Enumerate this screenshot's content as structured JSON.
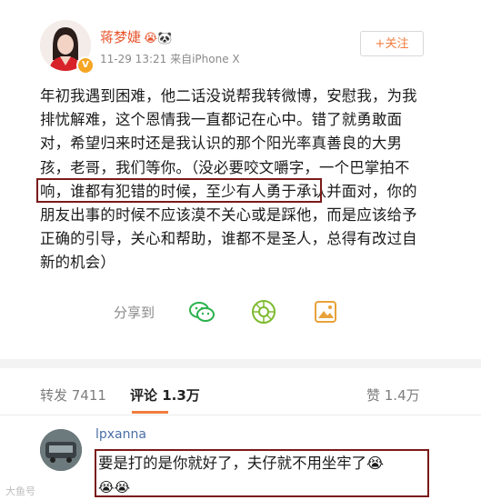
{
  "post": {
    "username": "蒋梦婕",
    "name_emojis": "😭🐼",
    "meta": "11-29 13:21  来自iPhone X",
    "follow_label": "+关注",
    "text": "年初我遇到困难，他二话没说帮我转微博，安慰我，为我排忧解难，这个恩情我一直都记在心中。错了就勇敢面对，希望归来时还是我认识的那个阳光率真善良的大男孩，老哥，我们等你。（没必要咬文嚼字，一个巴掌拍不响，谁都有犯错的时候，至少有人勇于承认并面对，你的朋友出事的时候不应该漠不关心或是踩他，而是应该给予正确的引导，关心和帮助，谁都不是圣人，总得有改过自新的机会）"
  },
  "share": {
    "label": "分享到",
    "icons": [
      "wechat-icon",
      "moments-icon",
      "album-icon"
    ]
  },
  "tabs": {
    "repost": "转发 7411",
    "comments": "评论 1.3万",
    "likes": "赞 1.4万"
  },
  "comment": {
    "username": "lpxanna",
    "text": "要是打的是你就好了，夫仔就不用坐牢了😭",
    "trailing_emojis": "😭😭"
  },
  "watermark": "大鱼号",
  "colors": {
    "username": "#e8542d",
    "accent": "#f07d3c",
    "box": "#7a1a1a",
    "link": "#4a6fa5"
  }
}
